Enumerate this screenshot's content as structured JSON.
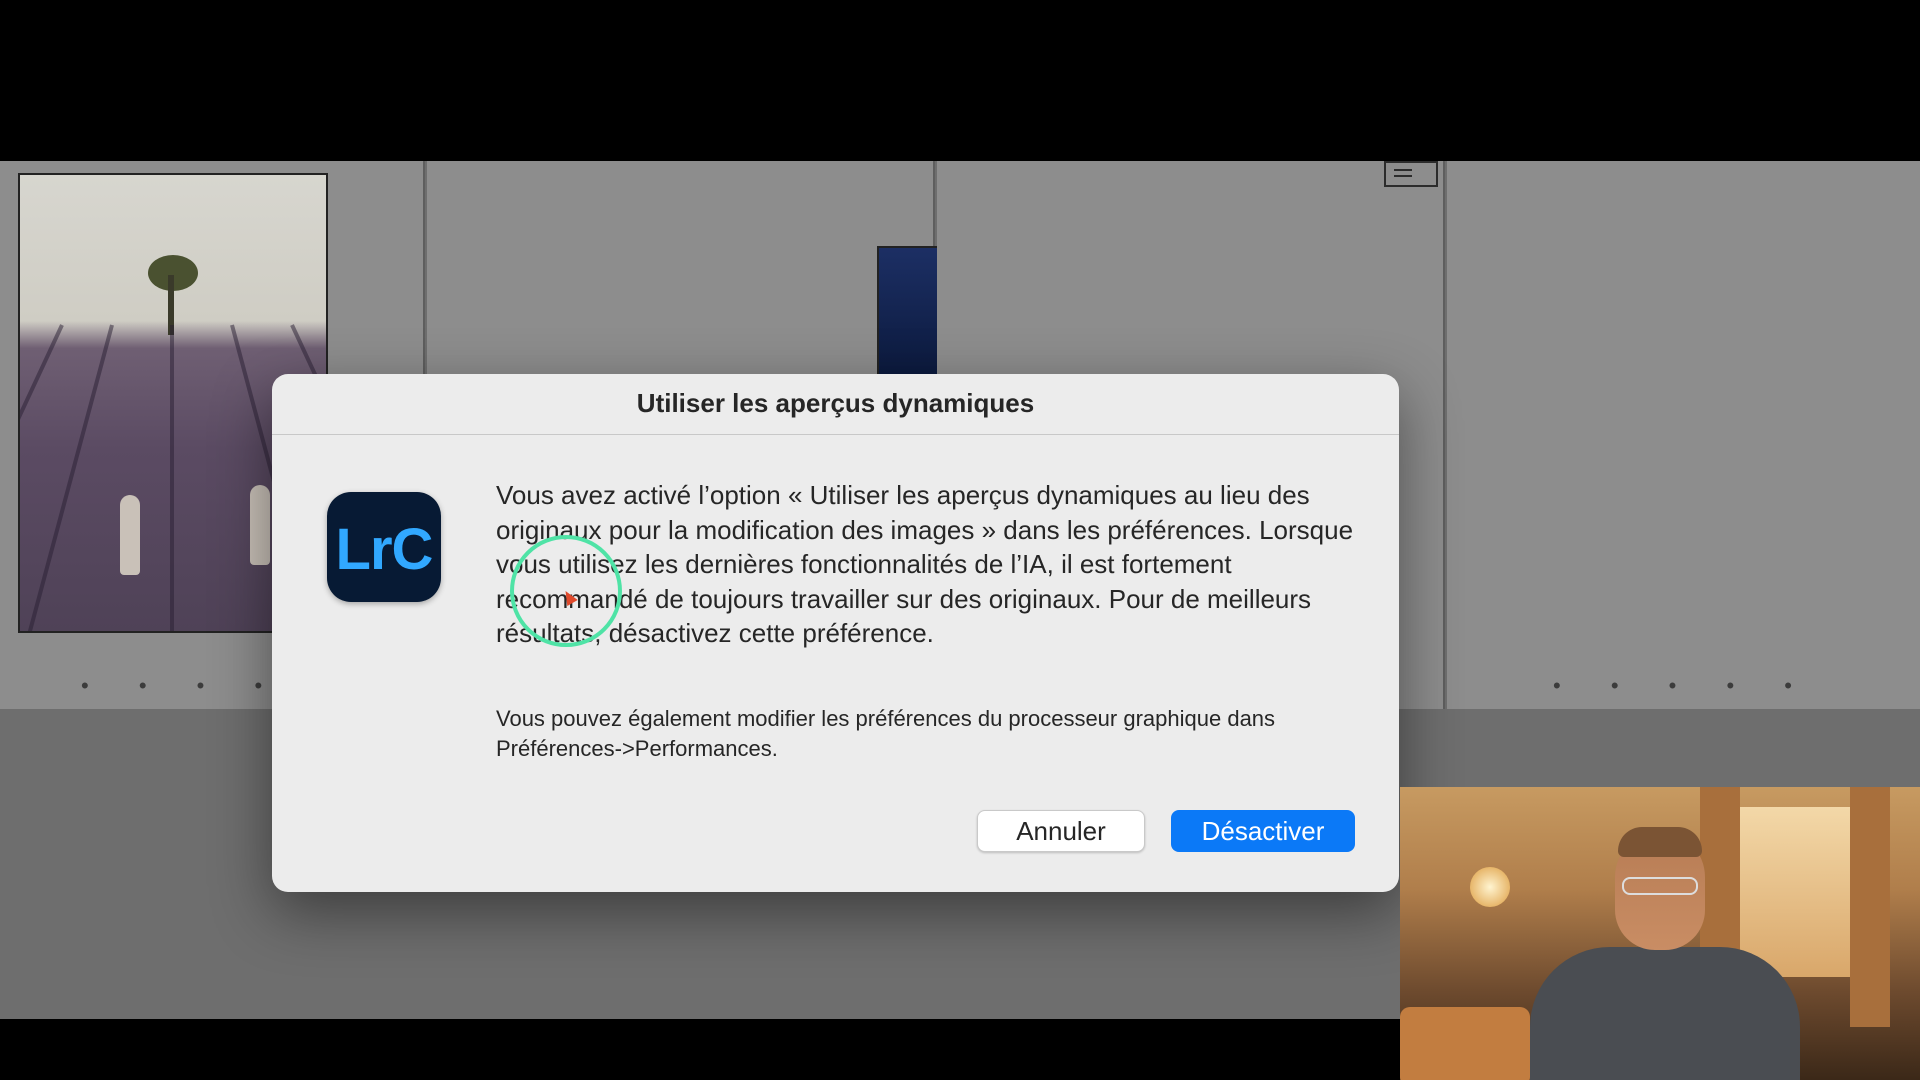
{
  "dialog": {
    "title": "Utiliser les aperçus dynamiques",
    "app_icon_text": "LrC",
    "message_main": "Vous avez activé l’option « Utiliser les aperçus dynamiques au lieu des originaux pour la modification des images » dans les préférences. Lorsque vous utilisez les dernières fonctionnalités de l’IA, il est fortement recommandé de toujours travailler sur des originaux. Pour de meilleurs résultats, désactivez cette préférence.",
    "message_sub": "Vous pouvez également modifier les préférences du processeur graphique dans Préférences->Performances.",
    "cancel_label": "Annuler",
    "confirm_label": "Désactiver"
  },
  "grid": {
    "footer_dots": "• • • • •"
  },
  "colors": {
    "primary_button": "#0b79f7",
    "dialog_bg": "#ececec",
    "grid_bg": "#8d8d8d",
    "lrc_icon_bg": "#071a34",
    "lrc_icon_text": "#31a8ff",
    "click_indicator": "#4fe3a6"
  },
  "icons": {
    "app": "lightroom-classic-icon",
    "cursor": "mouse-cursor-icon"
  }
}
